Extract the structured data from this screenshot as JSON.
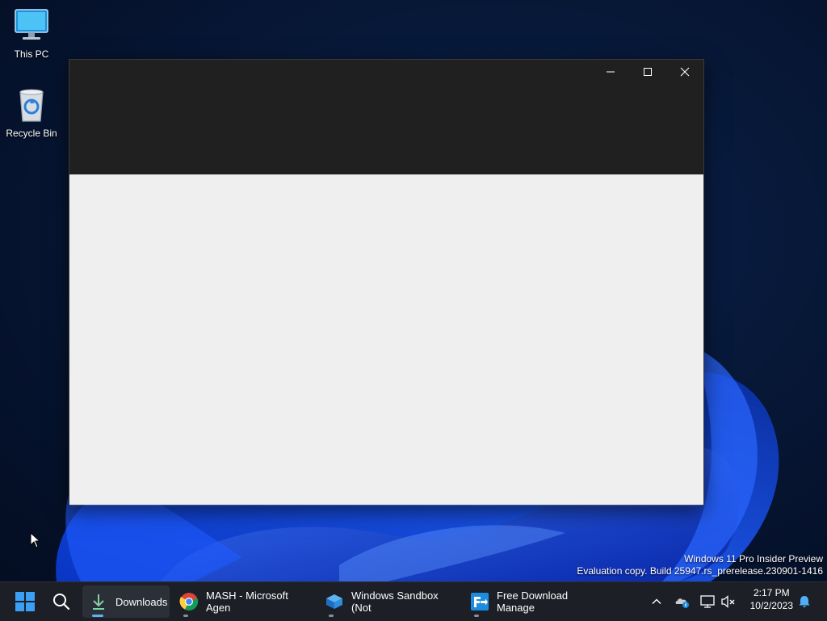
{
  "desktop": {
    "icons": [
      {
        "label": "This PC",
        "icon": "computer-monitor-icon"
      },
      {
        "label": "Recycle Bin",
        "icon": "recycle-bin-icon"
      }
    ],
    "watermark": {
      "line1": "Windows 11 Pro Insider Preview",
      "line2": "Evaluation copy. Build 25947.rs_prerelease.230901-1416"
    }
  },
  "window": {
    "controls": {
      "minimize": "minimize-icon",
      "maximize": "maximize-icon",
      "close": "close-icon"
    },
    "header_color": "#202020",
    "body_color": "#efefef"
  },
  "taskbar": {
    "start": "windows-start-icon",
    "search": "search-icon",
    "apps": [
      {
        "label": "Downloads",
        "icon": "download-arrow-icon",
        "active": true
      },
      {
        "label": "MASH - Microsoft Agen",
        "icon": "chrome-icon",
        "active": false
      },
      {
        "label": "Windows Sandbox (Not",
        "icon": "windows-sandbox-icon",
        "active": false
      },
      {
        "label": "Free Download Manage",
        "icon": "free-download-manager-icon",
        "active": false
      }
    ],
    "tray": {
      "icons": [
        "chevron-up-icon",
        "onedrive-info-icon",
        "network-icon",
        "volume-muted-icon",
        "notification-bell-icon"
      ],
      "time": "2:17 PM",
      "date": "10/2/2023"
    },
    "accent_color": "#5fb2f2"
  }
}
